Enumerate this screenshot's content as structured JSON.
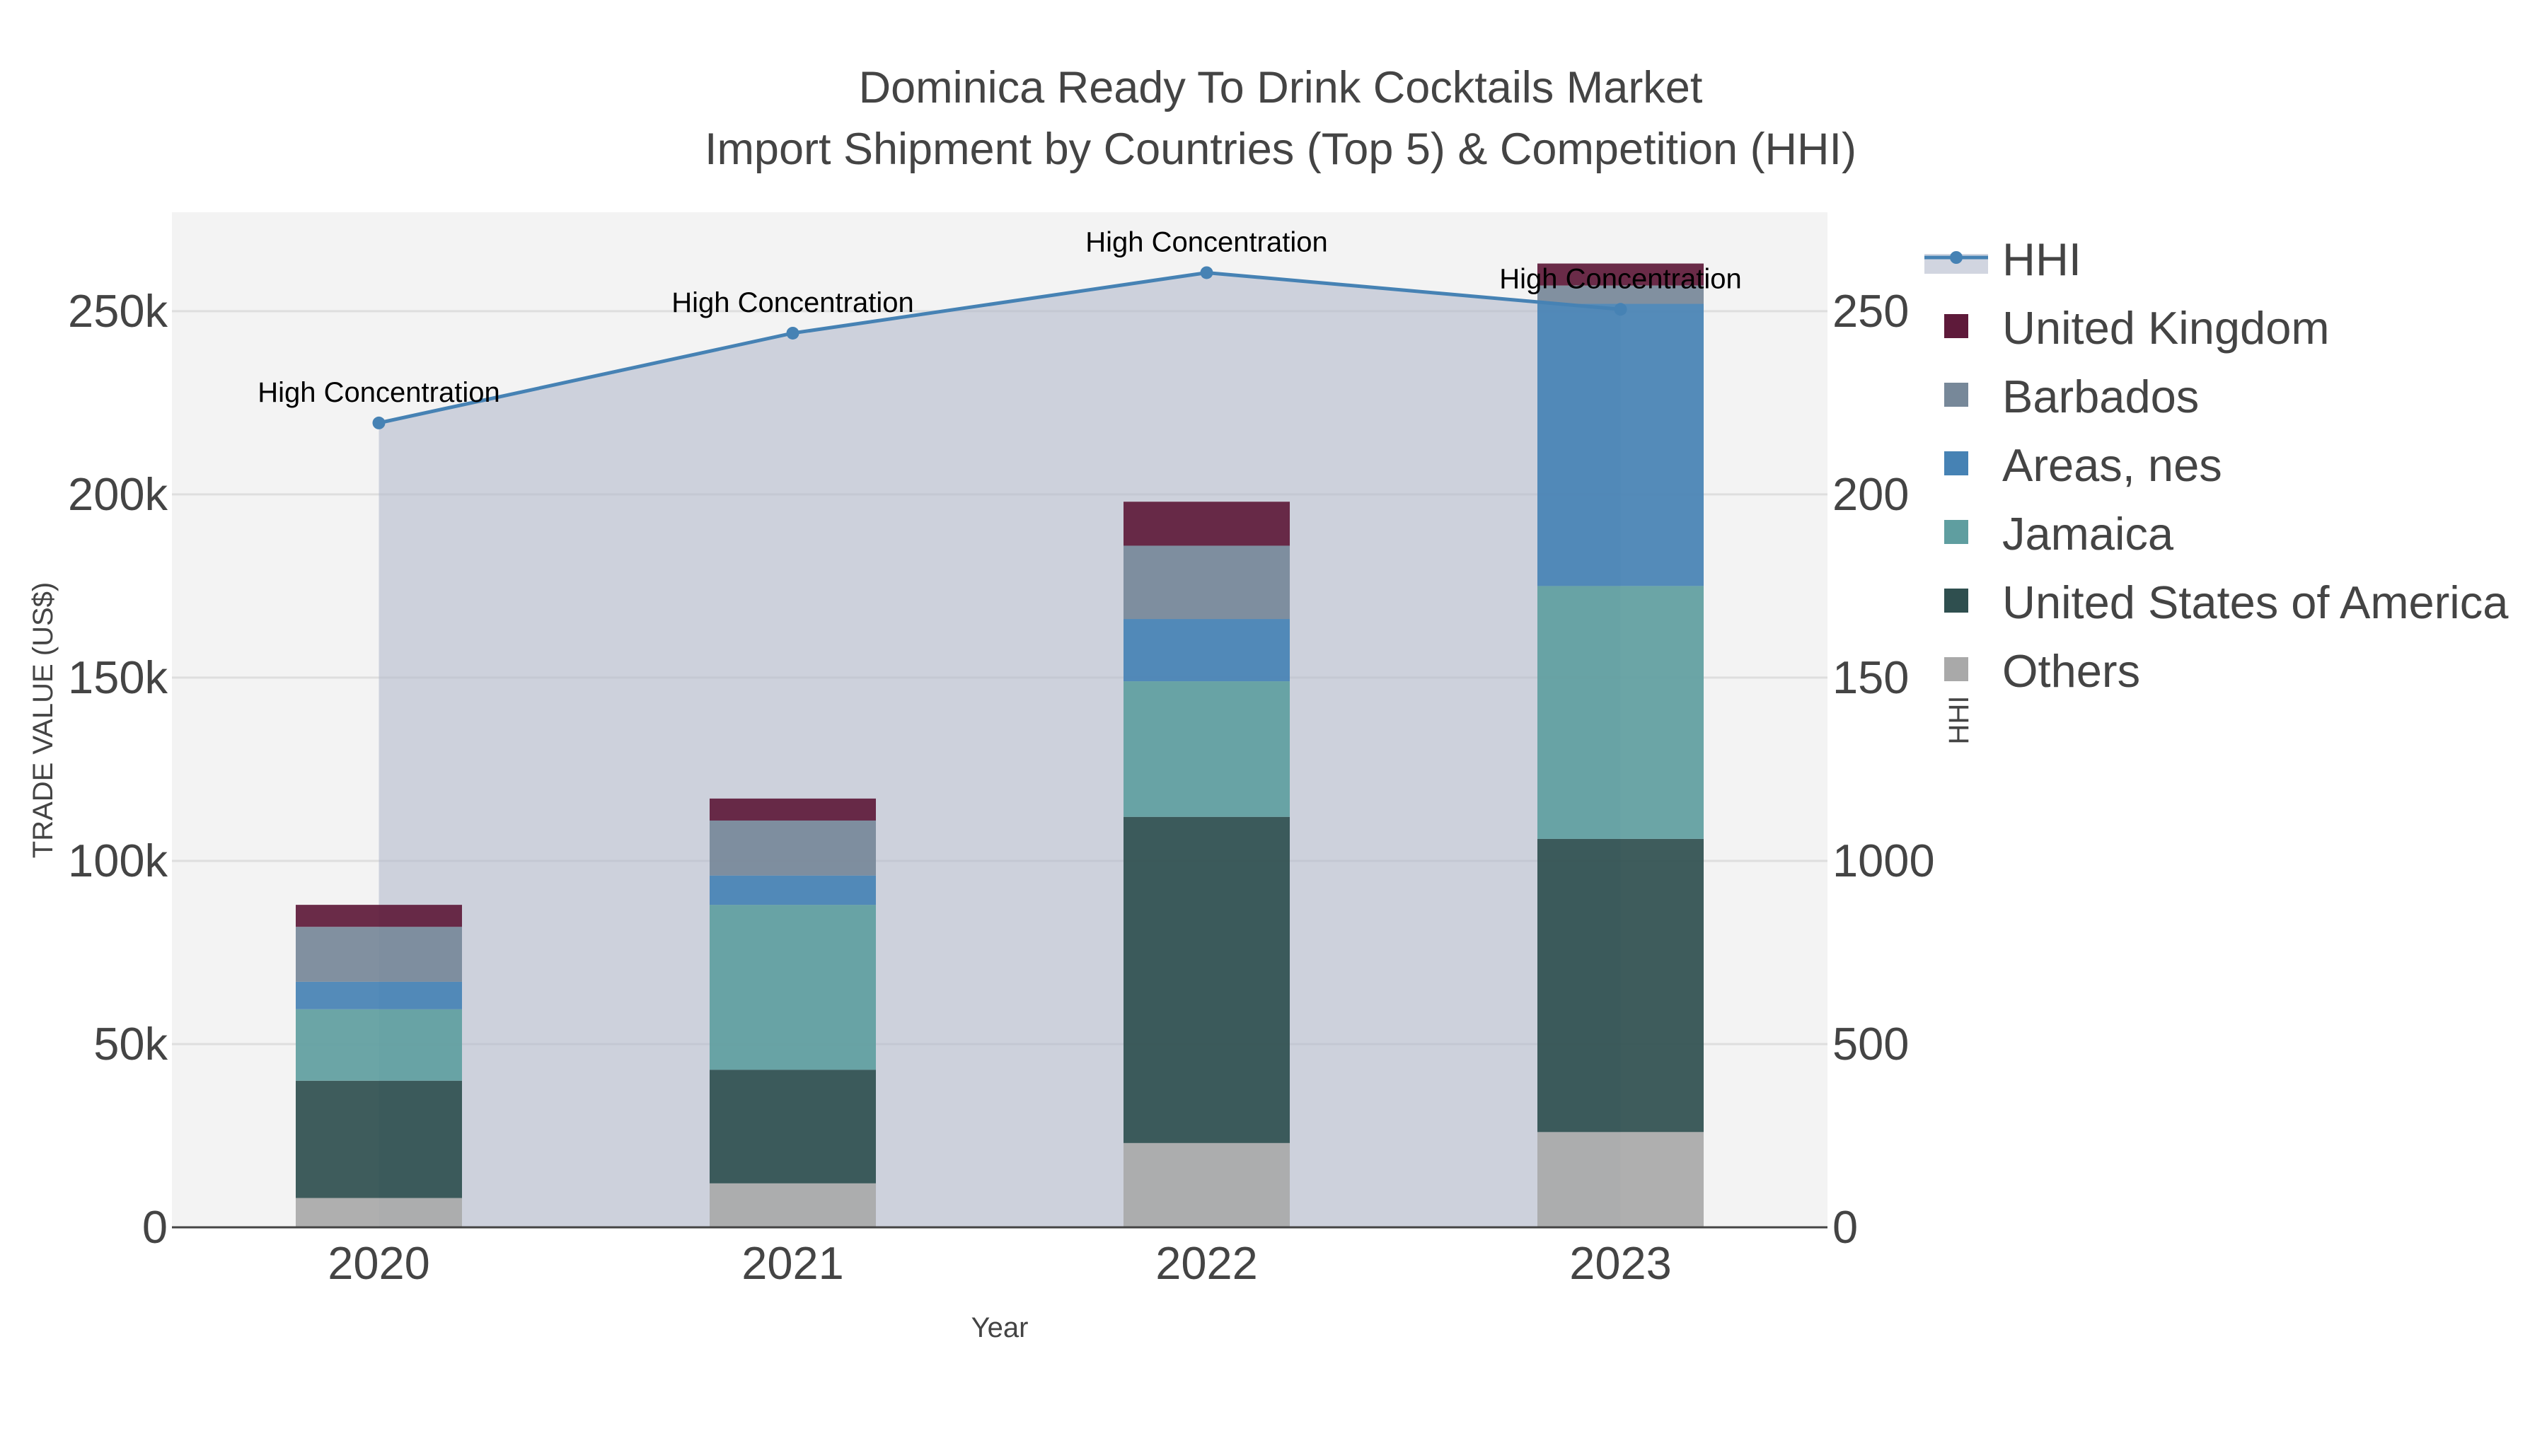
{
  "chart_data": {
    "type": "bar",
    "title": "Dominica Ready To Drink Cocktails Market",
    "subtitle": "Import Shipment by Countries (Top 5) & Competition (HHI)",
    "xlabel": "Year",
    "ylabel": "TRADE VALUE (US$)",
    "y2label": "HHI",
    "categories": [
      "2020",
      "2021",
      "2022",
      "2023"
    ],
    "ylim": [
      0,
      277000
    ],
    "y2lim": [
      0,
      2770
    ],
    "y_ticks": [
      {
        "value": 0,
        "label": "0"
      },
      {
        "value": 50000,
        "label": "50k"
      },
      {
        "value": 100000,
        "label": "100k"
      },
      {
        "value": 150000,
        "label": "150k"
      },
      {
        "value": 200000,
        "label": "200k"
      },
      {
        "value": 250000,
        "label": "250k"
      }
    ],
    "y2_ticks": [
      {
        "value": 0,
        "label": "0"
      },
      {
        "value": 500,
        "label": "500"
      },
      {
        "value": 1000,
        "label": "1000"
      },
      {
        "value": 1500,
        "label": "150"
      },
      {
        "value": 2000,
        "label": "200"
      },
      {
        "value": 2500,
        "label": "250"
      }
    ],
    "grid": true,
    "legend_position": "right",
    "series": [
      {
        "name": "Others",
        "color": "#a9a9a9",
        "values": [
          8000,
          12000,
          23000,
          26000
        ]
      },
      {
        "name": "United States of America",
        "color": "#2f4f4f",
        "values": [
          32000,
          31000,
          89000,
          80000
        ]
      },
      {
        "name": "Jamaica",
        "color": "#5f9ea0",
        "values": [
          19500,
          45000,
          37000,
          69000
        ]
      },
      {
        "name": "Areas, nes",
        "color": "#4682b4",
        "values": [
          7500,
          8000,
          17000,
          77000
        ]
      },
      {
        "name": "Barbados",
        "color": "#778899",
        "values": [
          15000,
          15000,
          20000,
          5000
        ]
      },
      {
        "name": "United Kingdom",
        "color": "#5e1a3a",
        "values": [
          6000,
          6000,
          12000,
          6000
        ]
      }
    ],
    "hhi": {
      "name": "HHI",
      "color": "#4682b4",
      "values": [
        2195,
        2440,
        2605,
        2505
      ],
      "annotations": [
        "High Concentration",
        "High Concentration",
        "High Concentration",
        "High Concentration"
      ]
    }
  }
}
